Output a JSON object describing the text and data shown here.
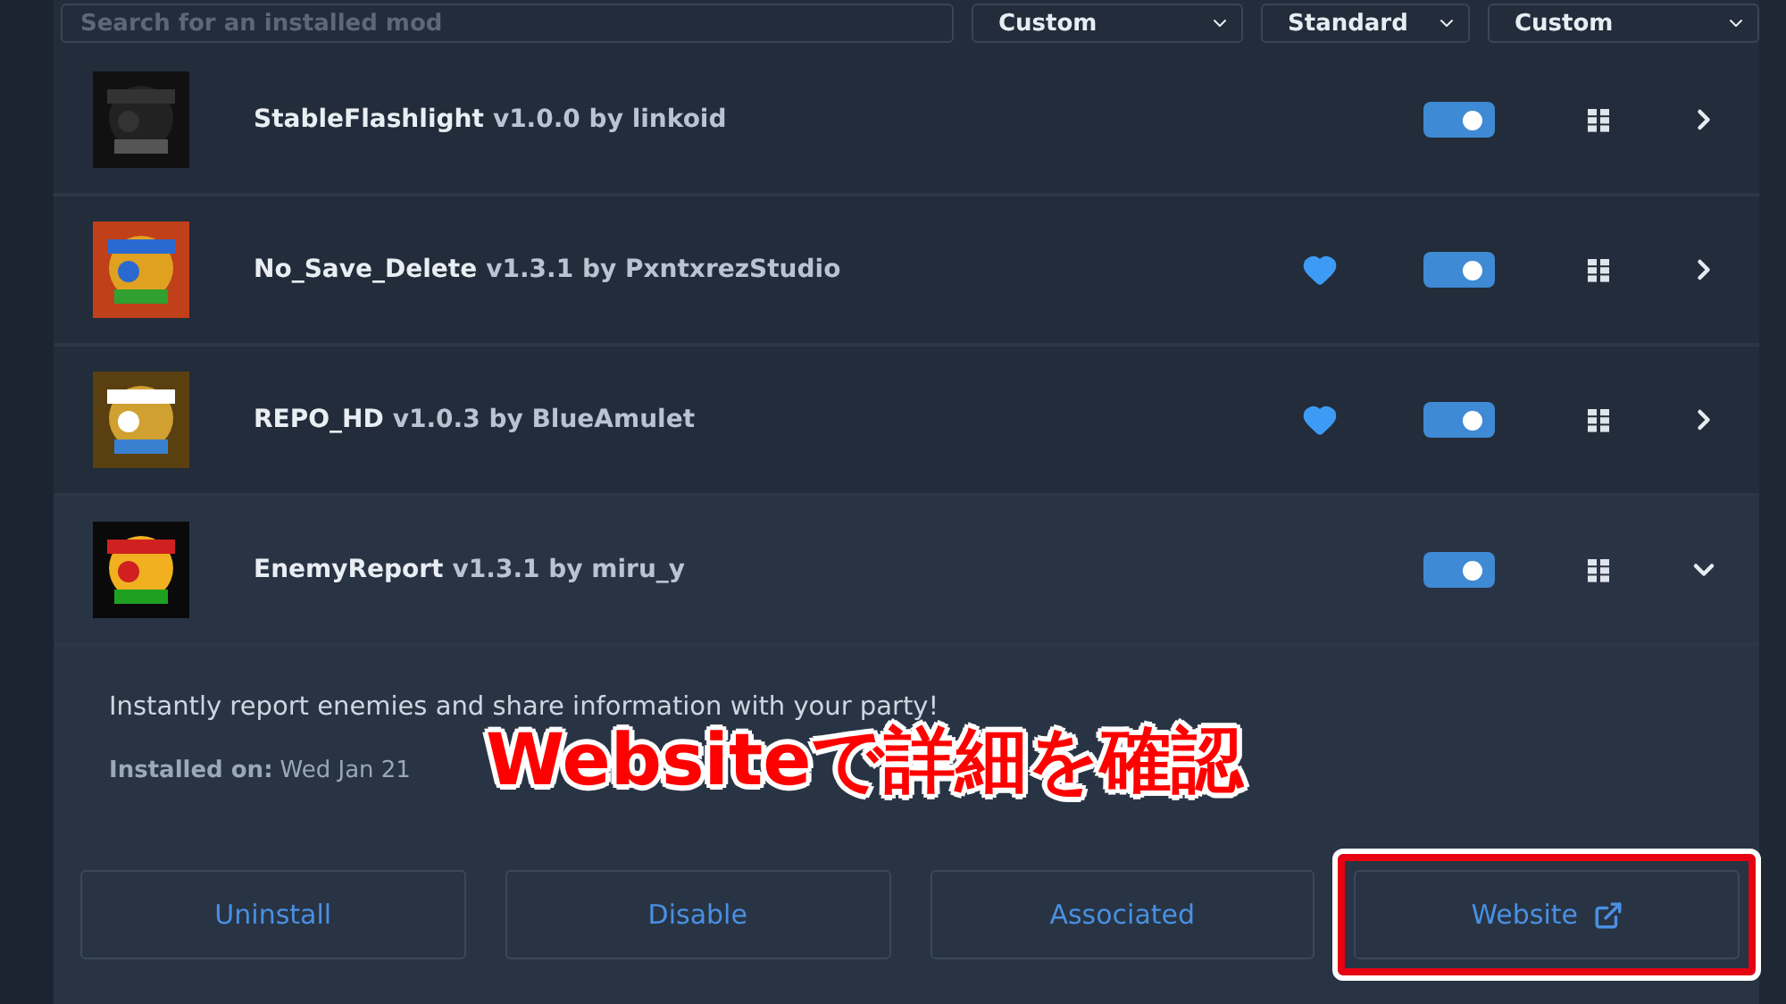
{
  "search": {
    "placeholder": "Search for an installed mod"
  },
  "filters": [
    {
      "label": "Custom"
    },
    {
      "label": "Standard"
    },
    {
      "label": "Custom"
    }
  ],
  "mods": [
    {
      "name": "StableFlashlight",
      "byline": "v1.0.0 by linkoid",
      "favorite": false,
      "enabled": true,
      "expanded": false
    },
    {
      "name": "No_Save_Delete",
      "byline": "v1.3.1 by PxntxrezStudio",
      "favorite": true,
      "enabled": true,
      "expanded": false
    },
    {
      "name": "REPO_HD",
      "byline": "v1.0.3 by BlueAmulet",
      "favorite": true,
      "enabled": true,
      "expanded": false
    },
    {
      "name": "EnemyReport",
      "byline": "v1.3.1 by miru_y",
      "favorite": false,
      "enabled": true,
      "expanded": true
    }
  ],
  "details": {
    "description": "Instantly report enemies and share information with your party!",
    "installed_label": "Installed on:",
    "installed_value": "Wed Jan 21",
    "buttons": [
      {
        "label": "Uninstall",
        "kind": "plain",
        "highlighted": false
      },
      {
        "label": "Disable",
        "kind": "plain",
        "highlighted": false
      },
      {
        "label": "Associated",
        "kind": "plain",
        "highlighted": false
      },
      {
        "label": "Website",
        "kind": "external",
        "highlighted": true
      }
    ]
  },
  "annotation": {
    "text": "Websiteで詳細を確認"
  }
}
